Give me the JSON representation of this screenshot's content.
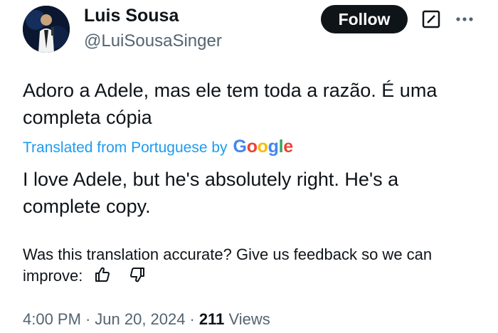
{
  "author": {
    "name": "Luis Sousa",
    "handle": "@LuiSousaSinger"
  },
  "actions": {
    "follow_label": "Follow"
  },
  "tweet": {
    "original_text": "Adoro a Adele, mas ele tem toda a razão. É uma completa cópia",
    "translated_from": "Translated from Portuguese by",
    "google_logo": "Google",
    "translation": "I love Adele, but he's absolutely right. He's a complete copy."
  },
  "feedback": {
    "text": "Was this translation accurate? Give us feedback so we can improve:"
  },
  "meta": {
    "time": "4:00 PM",
    "separator": "·",
    "date": "Jun 20, 2024",
    "views_count": "211",
    "views_label": "Views"
  },
  "icons": {
    "grok": "grok-icon",
    "more": "more-icon",
    "thumbs_up": "thumbs-up-icon",
    "thumbs_down": "thumbs-down-icon"
  },
  "colors": {
    "link": "#1d9bf0",
    "follow_bg": "#0f1419",
    "secondary_text": "#536471"
  }
}
